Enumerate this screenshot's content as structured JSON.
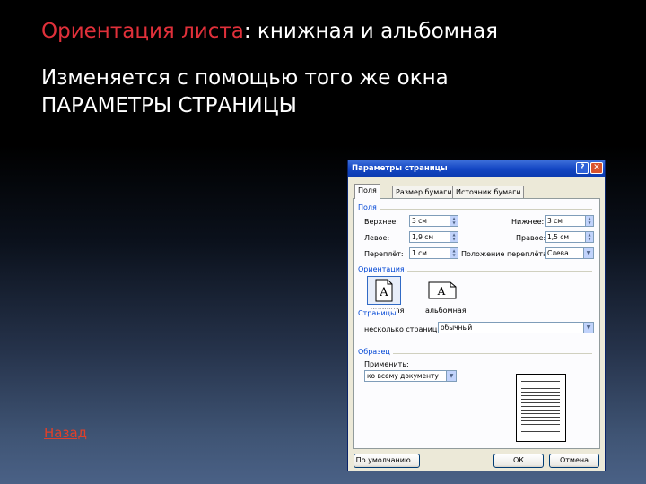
{
  "slide": {
    "title_accent": "Ориентация листа",
    "title_rest": ": книжная и альбомная",
    "body_line1": "Изменяется с помощью того же окна",
    "body_line2": "ПАРАМЕТРЫ СТРАНИЦЫ",
    "back_link": "Назад"
  },
  "dialog": {
    "title": "Параметры страницы",
    "help_label": "?",
    "close_label": "✕",
    "tabs": [
      {
        "label": "Поля",
        "active": true
      },
      {
        "label": "Размер бумаги",
        "active": false
      },
      {
        "label": "Источник бумаги",
        "active": false
      }
    ],
    "margins": {
      "group_label": "Поля",
      "top_label": "Верхнее:",
      "top_value": "3 см",
      "bottom_label": "Нижнее:",
      "bottom_value": "3 см",
      "left_label": "Левое:",
      "left_value": "1,9 см",
      "right_label": "Правое:",
      "right_value": "1,5 см",
      "gutter_label": "Переплёт:",
      "gutter_value": "1 см",
      "gutter_pos_label": "Положение переплёта:",
      "gutter_pos_value": "Слева"
    },
    "orientation": {
      "group_label": "Ориентация",
      "portrait_label": "книжная",
      "landscape_label": "альбомная",
      "icon_letter": "A",
      "selected": "portrait"
    },
    "pages": {
      "group_label": "Страницы",
      "multiple_label": "несколько страниц:",
      "multiple_value": "обычный"
    },
    "preview": {
      "group_label": "Образец",
      "apply_label": "Применить:",
      "apply_value": "ко всему документу"
    },
    "buttons": {
      "default_label": "По умолчанию...",
      "ok_label": "ОК",
      "cancel_label": "Отмена"
    },
    "colors": {
      "titlebar": "#0c3bb0",
      "group_label": "#0046d5",
      "face": "#ece9d8"
    }
  }
}
